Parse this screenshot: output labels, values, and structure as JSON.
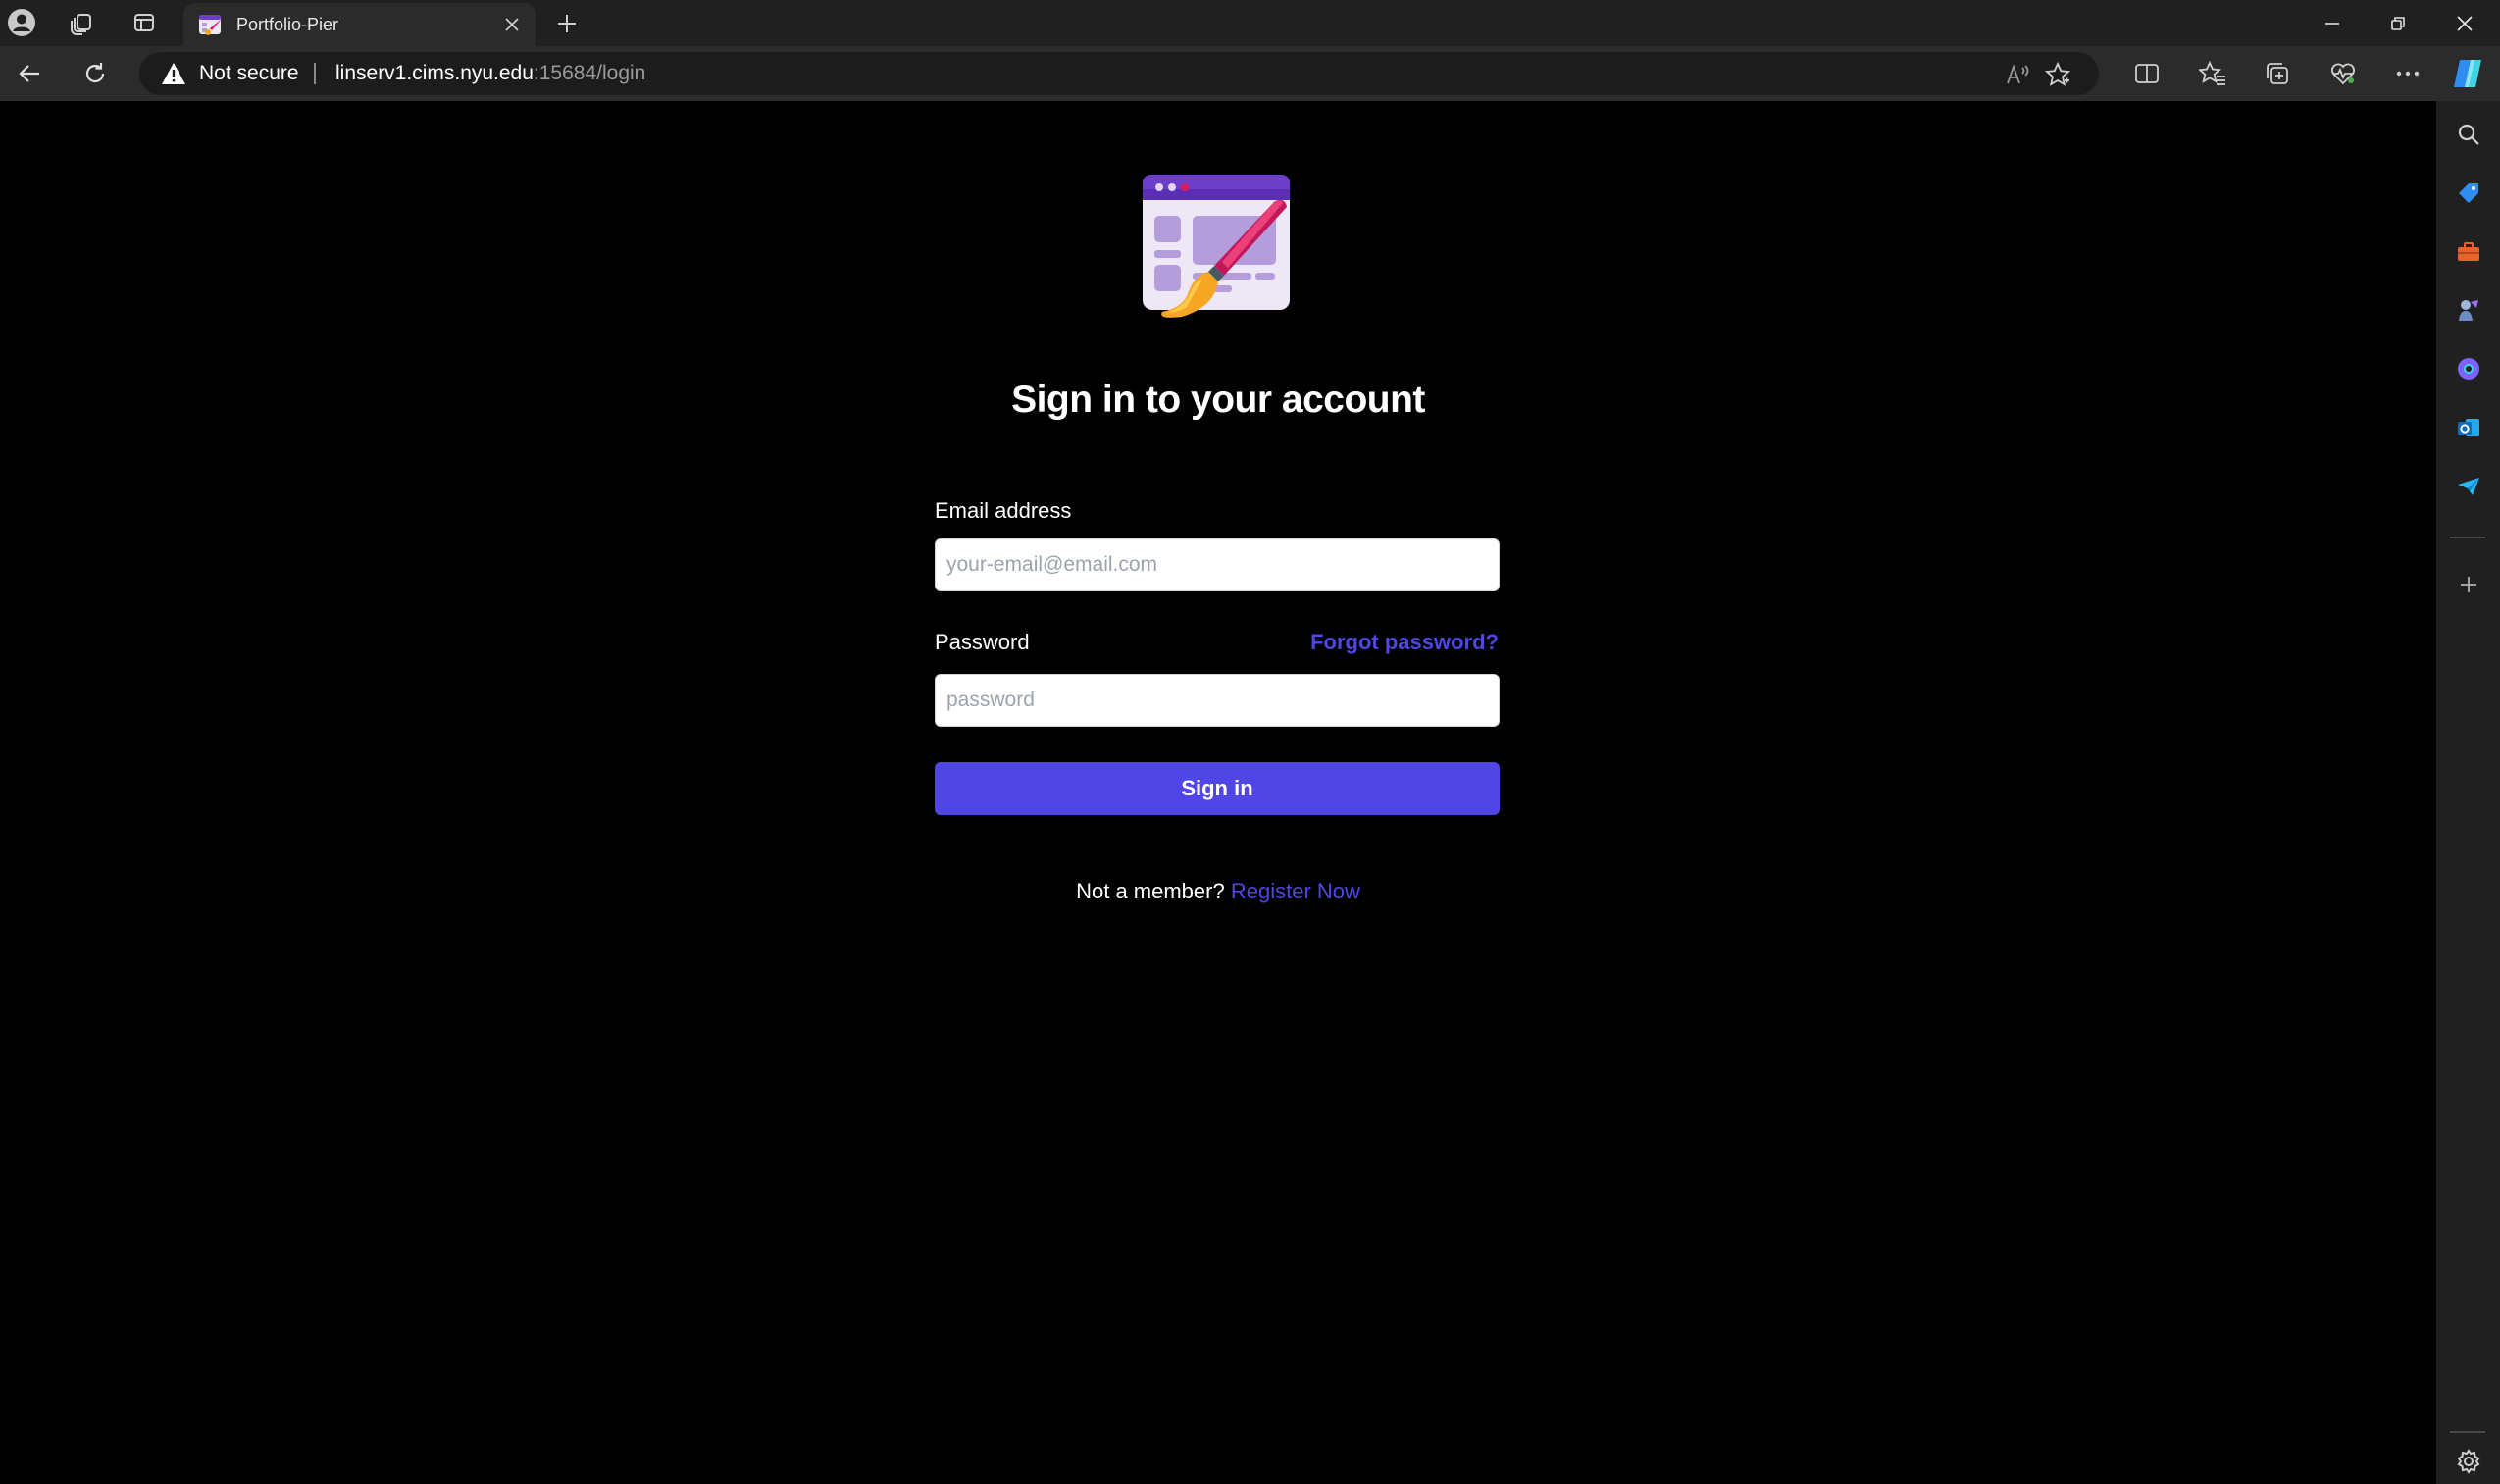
{
  "browser": {
    "tab": {
      "title": "Portfolio-Pier"
    },
    "address": {
      "security_label": "Not secure",
      "url_host": "linserv1.cims.nyu.edu",
      "url_rest": ":15684/login"
    },
    "colors": {
      "titlebar_bg": "#202020",
      "toolbar_bg": "#2b2b2b",
      "omnibox_bg": "#1c1c1c"
    }
  },
  "login": {
    "heading": "Sign in to your account",
    "email_label": "Email address",
    "email_value": "",
    "email_placeholder": "your-email@email.com",
    "password_label": "Password",
    "password_value": "",
    "password_placeholder": "password",
    "forgot_link": "Forgot password?",
    "submit_label": "Sign in",
    "register_prompt": "Not a member?",
    "register_link": "Register Now",
    "accent_color": "#4f46e5"
  },
  "icons": {
    "titlebar": [
      "profile-icon",
      "workspaces-icon",
      "tab-actions-icon",
      "tab-favicon",
      "tab-close-icon",
      "new-tab-icon",
      "minimize-icon",
      "restore-icon",
      "close-window-icon"
    ],
    "toolbar": [
      "back-icon",
      "refresh-icon",
      "warning-icon",
      "read-aloud-icon",
      "favorite-star-icon",
      "split-screen-icon",
      "favorites-icon",
      "collections-icon",
      "browser-essentials-icon",
      "more-icon",
      "copilot-icon"
    ],
    "sidebar": [
      "search-icon",
      "shopping-tag-icon",
      "tools-icon",
      "games-icon",
      "copilot-sidebar-icon",
      "outlook-icon",
      "drop-icon",
      "add-icon",
      "settings-icon"
    ]
  }
}
